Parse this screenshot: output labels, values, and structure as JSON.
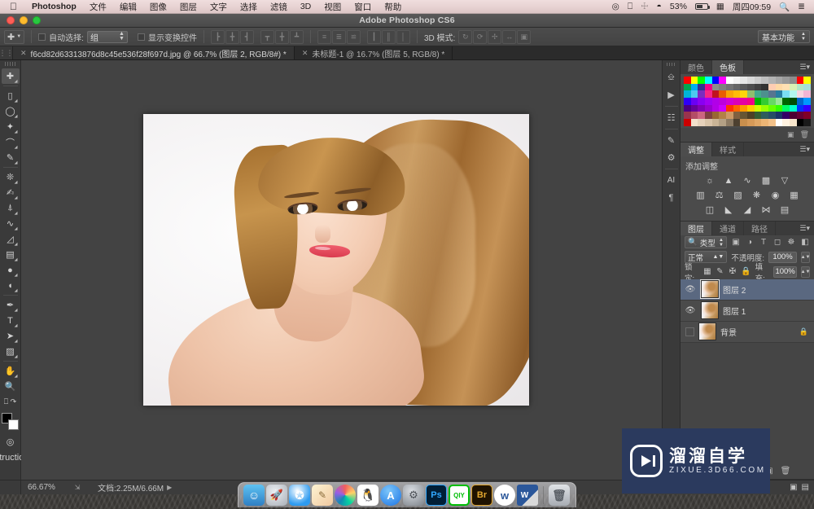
{
  "menubar": {
    "apple_icon": "apple-icon",
    "app_name": "Photoshop",
    "items": [
      "文件",
      "编辑",
      "图像",
      "图层",
      "文字",
      "选择",
      "滤镜",
      "3D",
      "视图",
      "窗口",
      "帮助"
    ],
    "status": {
      "airplay_icon": "airplay-icon",
      "display_icon": "display-icon",
      "bluetooth_icon": "bluetooth-icon",
      "wifi_icon": "wifi-icon",
      "battery_percent": "53%",
      "battery_icon": "battery-icon",
      "input_icon": "input-source-icon",
      "clock": "周四09:59",
      "search_icon": "search-icon",
      "notifications_icon": "notification-list-icon"
    }
  },
  "window": {
    "title": "Adobe Photoshop CS6"
  },
  "options_bar": {
    "tool_icon": "move-tool-icon",
    "tool_dropdown_icon": "chevron-down-icon",
    "auto_select_checked": false,
    "auto_select_label": "自动选择:",
    "auto_select_value": "组",
    "show_transform_checked": false,
    "show_transform_label": "显示变换控件",
    "align_icons": [
      "align-left-edges-icon",
      "align-horizontal-centers-icon",
      "align-right-edges-icon",
      "align-top-edges-icon",
      "align-vertical-centers-icon",
      "align-bottom-edges-icon",
      "distribute-top-icon",
      "distribute-vertical-center-icon",
      "distribute-bottom-icon",
      "distribute-left-icon",
      "distribute-horizontal-center-icon",
      "distribute-right-icon"
    ],
    "three_d_label": "3D 模式:",
    "three_d_icons": [
      "rotate-3d-icon",
      "roll-3d-icon",
      "drag-3d-icon",
      "slide-3d-icon",
      "scale-3d-icon"
    ],
    "workspace_value": "基本功能",
    "workspace_arrow_icon": "chevron-down-icon"
  },
  "tabs": [
    {
      "label": "f6cd82d63313876d8c45e536f28f697d.jpg @ 66.7% (图层 2, RGB/8#) *",
      "active": true,
      "close_icon": "close-icon"
    },
    {
      "label": "未标题-1 @ 16.7% (图层 5, RGB/8) *",
      "active": false,
      "close_icon": "close-icon"
    }
  ],
  "toolbar": {
    "tools": [
      {
        "name": "move-tool",
        "glyph": "✛",
        "selected": true,
        "sub": false
      },
      {
        "name": "rectangular-marquee-tool",
        "glyph": "▭",
        "selected": false,
        "sub": true
      },
      {
        "name": "lasso-tool",
        "glyph": "◯",
        "selected": false,
        "sub": true
      },
      {
        "name": "quick-selection-tool",
        "glyph": "✧",
        "selected": false,
        "sub": true
      },
      {
        "name": "crop-tool",
        "glyph": "⌗",
        "selected": false,
        "sub": true
      },
      {
        "name": "eyedropper-tool",
        "glyph": "✐",
        "selected": false,
        "sub": true
      },
      {
        "name": "spot-healing-brush-tool",
        "glyph": "❂",
        "selected": false,
        "sub": true
      },
      {
        "name": "brush-tool",
        "glyph": "✎",
        "selected": false,
        "sub": true
      },
      {
        "name": "clone-stamp-tool",
        "glyph": "⊥",
        "selected": false,
        "sub": true
      },
      {
        "name": "history-brush-tool",
        "glyph": "∿",
        "selected": false,
        "sub": true
      },
      {
        "name": "eraser-tool",
        "glyph": "◩",
        "selected": false,
        "sub": true
      },
      {
        "name": "gradient-tool",
        "glyph": "▤",
        "selected": false,
        "sub": true
      },
      {
        "name": "blur-tool",
        "glyph": "💧",
        "selected": false,
        "sub": true
      },
      {
        "name": "dodge-tool",
        "glyph": "🔍",
        "selected": false,
        "sub": true
      },
      {
        "name": "pen-tool",
        "glyph": "✒",
        "selected": false,
        "sub": true
      },
      {
        "name": "horizontal-type-tool",
        "glyph": "T",
        "selected": false,
        "sub": true
      },
      {
        "name": "path-selection-tool",
        "glyph": "➤",
        "selected": false,
        "sub": true
      },
      {
        "name": "rectangle-shape-tool",
        "glyph": "❏",
        "selected": false,
        "sub": true
      },
      {
        "name": "hand-tool",
        "glyph": "✋",
        "selected": false,
        "sub": true
      },
      {
        "name": "zoom-tool",
        "glyph": "🔎",
        "selected": false,
        "sub": false
      }
    ],
    "quickmask_icon": "quick-mask-icon",
    "screenmode_icon": "screen-mode-icon",
    "foreground_color": "#000000",
    "background_color": "#ffffff",
    "swap_icon": "swap-colors-icon",
    "default_icon": "default-colors-icon"
  },
  "status_bar": {
    "zoom": "66.67%",
    "resize_icon": "resize-handle-icon",
    "doc_info": "文档:2.25M/6.66M",
    "expand_icon": "play-arrow-icon",
    "right_icons": [
      "collapse-icon",
      "expand-icon"
    ]
  },
  "mini_dock": {
    "icons": [
      "history-panel-icon",
      "actions-panel-icon",
      "mini-bridge-icon",
      "brush-panel-icon",
      "brush-presets-icon",
      "character-panel-icon",
      "paragraph-panel-icon"
    ]
  },
  "panels": {
    "color_panel": {
      "tabs": [
        {
          "label": "颜色",
          "active": false
        },
        {
          "label": "色板",
          "active": true
        }
      ],
      "menu_icon": "panel-menu-icon",
      "swatch_rows": [
        [
          "#ff0000",
          "#ffff00",
          "#00ff00",
          "#00ffff",
          "#0000ff",
          "#ff00ff",
          "#ffffff",
          "#f2f2f2",
          "#e6e6e6",
          "#d9d9d9",
          "#cccccc",
          "#bfbfbf",
          "#b3b3b3",
          "#a6a6a6",
          "#999999",
          "#8c8c8c",
          "#ff0000",
          "#ffff00"
        ],
        [
          "#00a651",
          "#00aeef",
          "#2e3192",
          "#ec008c",
          "#8c8c8c",
          "#808080",
          "#737373",
          "#666666",
          "#595959",
          "#4d4d4d",
          "#404040",
          "#333333",
          "#ffcdb3",
          "#ffd9a6",
          "#ffe0b3",
          "#d9f0b3",
          "#b3e6c6",
          "#a6e0d9"
        ],
        [
          "#00b4d8",
          "#4cc9f0",
          "#7b2cbf",
          "#f72585",
          "#c1121f",
          "#e85d04",
          "#faa307",
          "#ffba08",
          "#ffd60a",
          "#90be6d",
          "#43aa8b",
          "#4d908e",
          "#577590",
          "#277da1",
          "#7bdff2",
          "#b2f7ef",
          "#f7d6e0",
          "#f2b5d4"
        ],
        [
          "#2d00f7",
          "#6a00f4",
          "#8900f2",
          "#a100f2",
          "#b100e8",
          "#bc00dd",
          "#d100d1",
          "#db00b6",
          "#e500a4",
          "#f20089",
          "#00b300",
          "#33cc33",
          "#66d966",
          "#99e699",
          "#006600",
          "#004d00",
          "#0066cc",
          "#0099ff"
        ],
        [
          "#4a0080",
          "#660099",
          "#8000b3",
          "#9900cc",
          "#b300e6",
          "#cc00ff",
          "#ff3300",
          "#ff6600",
          "#ff9900",
          "#ffcc00",
          "#ccff00",
          "#99ff00",
          "#66ff00",
          "#33ff00",
          "#00ff66",
          "#00ffcc",
          "#0033ff",
          "#3300ff"
        ],
        [
          "#99334d",
          "#b34d66",
          "#cc6680",
          "#804040",
          "#996633",
          "#b38047",
          "#cc9966",
          "#806040",
          "#665533",
          "#4d4026",
          "#335c33",
          "#2d5c5c",
          "#264d66",
          "#1a3366",
          "#330066",
          "#4d0033",
          "#660033",
          "#800026"
        ],
        [
          "#cc0000",
          "#f2e0cc",
          "#e6d2bb",
          "#d9c4a9",
          "#c9b496",
          "#b3a085",
          "#8c7a63",
          "#4d4030",
          "#c98f4d",
          "#d69a58",
          "#e0a766",
          "#ecb575",
          "#f2c189",
          "#ffffff",
          "#fff2e0",
          "#f7e6cc",
          "#000000",
          "#1a1a1a"
        ]
      ],
      "footer_icons": [
        "new-swatch-icon",
        "delete-swatch-icon"
      ]
    },
    "adjustments_panel": {
      "tabs": [
        {
          "label": "调整",
          "active": true
        },
        {
          "label": "样式",
          "active": false
        }
      ],
      "menu_icon": "panel-menu-icon",
      "header": "添加调整",
      "rows": [
        [
          {
            "name": "brightness-contrast-adjustment-icon",
            "glyph": "☀"
          },
          {
            "name": "levels-adjustment-icon",
            "glyph": "⏶"
          },
          {
            "name": "curves-adjustment-icon",
            "glyph": "∿"
          },
          {
            "name": "exposure-adjustment-icon",
            "glyph": "◪"
          },
          {
            "name": "vibrance-adjustment-icon",
            "glyph": "▽"
          }
        ],
        [
          {
            "name": "hue-saturation-adjustment-icon",
            "glyph": "▥"
          },
          {
            "name": "color-balance-adjustment-icon",
            "glyph": "⚖"
          },
          {
            "name": "black-white-adjustment-icon",
            "glyph": "◨"
          },
          {
            "name": "photo-filter-adjustment-icon",
            "glyph": "❂"
          },
          {
            "name": "channel-mixer-adjustment-icon",
            "glyph": "◉"
          },
          {
            "name": "color-lookup-adjustment-icon",
            "glyph": "▦"
          }
        ],
        [
          {
            "name": "invert-adjustment-icon",
            "glyph": "◫"
          },
          {
            "name": "posterize-adjustment-icon",
            "glyph": "◣"
          },
          {
            "name": "threshold-adjustment-icon",
            "glyph": "◤"
          },
          {
            "name": "selective-color-adjustment-icon",
            "glyph": "⋈"
          },
          {
            "name": "gradient-map-adjustment-icon",
            "glyph": "▤"
          }
        ]
      ]
    },
    "layers_panel": {
      "tabs": [
        {
          "label": "图层",
          "active": true
        },
        {
          "label": "通道",
          "active": false
        },
        {
          "label": "路径",
          "active": false
        }
      ],
      "menu_icon": "panel-menu-icon",
      "filter": {
        "search_icon": "search-icon",
        "value": "类型",
        "arrow_icon": "chevron-down-icon",
        "kind_icons": [
          "pixel-filter-icon",
          "adjustment-filter-icon",
          "type-filter-icon",
          "shape-filter-icon",
          "smart-object-filter-icon"
        ],
        "toggle_icon": "filter-toggle-icon"
      },
      "blend_mode": "正常",
      "opacity_label": "不透明度:",
      "opacity_value": "100%",
      "lock_label": "锁定:",
      "lock_icons": [
        "lock-transparent-pixels-icon",
        "lock-image-pixels-icon",
        "lock-position-icon",
        "lock-all-icon"
      ],
      "fill_label": "填充:",
      "fill_value": "100%",
      "layers": [
        {
          "name": "图层 2",
          "visible": true,
          "selected": true,
          "locked": false,
          "eye_icon": "eye-icon"
        },
        {
          "name": "图层 1",
          "visible": true,
          "selected": false,
          "locked": false,
          "eye_icon": "eye-icon"
        },
        {
          "name": "背景",
          "visible": false,
          "selected": false,
          "locked": true,
          "eye_icon": "eye-icon",
          "lock_icon": "lock-icon"
        }
      ],
      "footer_icons": [
        "link-layers-icon",
        "layer-style-icon",
        "layer-mask-icon",
        "new-fill-adjustment-icon",
        "new-group-icon",
        "new-layer-icon",
        "delete-layer-icon"
      ]
    }
  },
  "watermark": {
    "chinese": "溜溜自学",
    "english": "ZIXUE.3D66.COM",
    "logo_icon": "play-button-logo-icon",
    "background_color": "#2b3a5e"
  },
  "dock": {
    "items": [
      {
        "name": "finder",
        "label": "",
        "color": "#3a9bdc",
        "running": true
      },
      {
        "name": "launchpad",
        "label": "",
        "color": "#b6b9bd",
        "running": false
      },
      {
        "name": "safari",
        "label": "",
        "color": "#2e9bf0",
        "running": true
      },
      {
        "name": "stickies",
        "label": "",
        "color": "#f3e6c8",
        "running": false
      },
      {
        "name": "photos",
        "label": "",
        "color": "#f4f4f4",
        "running": false
      },
      {
        "name": "qq",
        "label": "",
        "color": "#ffffff",
        "running": false
      },
      {
        "name": "app-store",
        "label": "",
        "color": "#2b8ef0",
        "running": false
      },
      {
        "name": "system-preferences",
        "label": "",
        "color": "#8a8a8a",
        "running": false
      },
      {
        "name": "photoshop",
        "label": "Ps",
        "color": "#001e36",
        "running": true
      },
      {
        "name": "iqiyi",
        "label": "QIY",
        "color": "#00be06",
        "running": true
      },
      {
        "name": "bridge",
        "label": "Br",
        "color": "#1f1200",
        "running": true
      },
      {
        "name": "wps-writer",
        "label": "w",
        "color": "#ffffff",
        "running": true
      },
      {
        "name": "microsoft-word",
        "label": "W",
        "color": "#2b579a",
        "running": false
      }
    ],
    "trash": {
      "name": "trash",
      "label": ""
    }
  }
}
